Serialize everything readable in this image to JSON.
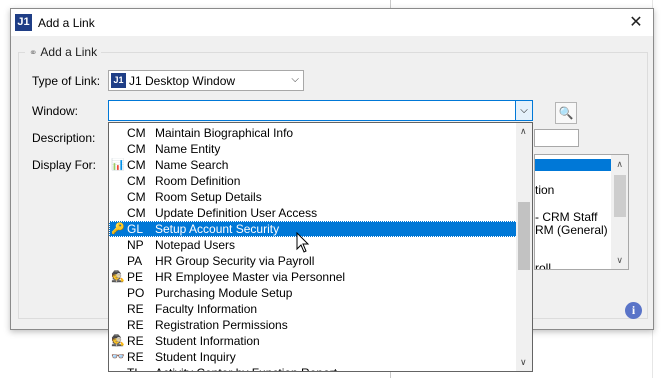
{
  "window": {
    "title": "Add a Link",
    "app_icon": "J1"
  },
  "group": {
    "legend": "Add a Link"
  },
  "form": {
    "type_label": "Type of Link:",
    "type_value": "J1 Desktop Window",
    "window_label": "Window:",
    "window_value": "",
    "description_label": "Description:",
    "display_label": "Display For:"
  },
  "display_list": {
    "rows": [
      "tion",
      "- CRM Staff",
      "RM (General)",
      "roll"
    ]
  },
  "dropdown": {
    "items": [
      {
        "module": "CM",
        "name": "Maintain Biographical Info",
        "icon": ""
      },
      {
        "module": "CM",
        "name": "Name Entity",
        "icon": ""
      },
      {
        "module": "CM",
        "name": "Name Search",
        "icon": "person-chart-icon"
      },
      {
        "module": "CM",
        "name": "Room Definition",
        "icon": ""
      },
      {
        "module": "CM",
        "name": "Room Setup Details",
        "icon": ""
      },
      {
        "module": "CM",
        "name": "Update Definition User Access",
        "icon": ""
      },
      {
        "module": "GL",
        "name": "Setup Account Security",
        "icon": "lock-key-icon",
        "selected": true
      },
      {
        "module": "NP",
        "name": "Notepad Users",
        "icon": ""
      },
      {
        "module": "PA",
        "name": "HR Group Security via Payroll",
        "icon": ""
      },
      {
        "module": "PE",
        "name": "HR Employee Master via Personnel",
        "icon": "spy-icon"
      },
      {
        "module": "PO",
        "name": "Purchasing Module Setup",
        "icon": ""
      },
      {
        "module": "RE",
        "name": "Faculty Information",
        "icon": ""
      },
      {
        "module": "RE",
        "name": "Registration Permissions",
        "icon": ""
      },
      {
        "module": "RE",
        "name": "Student Information",
        "icon": "spy-icon"
      },
      {
        "module": "RE",
        "name": "Student Inquiry",
        "icon": "spy-glasses-icon"
      },
      {
        "module": "TL",
        "name": "Activity Center by Function Report",
        "icon": ""
      }
    ]
  }
}
